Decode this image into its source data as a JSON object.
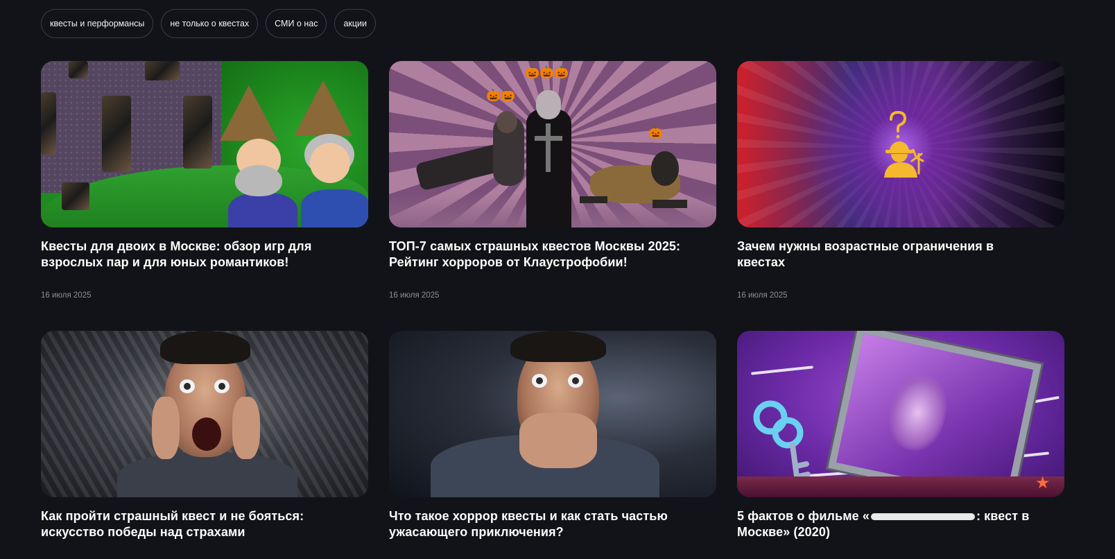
{
  "filters": [
    {
      "label": "квесты и перформансы"
    },
    {
      "label": "не только о квестах"
    },
    {
      "label": "СМИ о нас"
    },
    {
      "label": "акции"
    }
  ],
  "articles": [
    {
      "title": "Квесты для двоих в Москве: обзор игр для взрослых пар и для юных романтиков!",
      "date": "16 июля 2025"
    },
    {
      "title": "ТОП-7 самых страшных квестов Москвы 2025: Рейтинг хорроров от Клаустрофобии!",
      "date": "16 июля 2025"
    },
    {
      "title": "Зачем нужны возрастные ограничения в квестах",
      "date": "16 июля 2025"
    },
    {
      "title": "Как пройти страшный квест и не бояться: искусство победы над страхами"
    },
    {
      "title": "Что такое хоррор квесты и как стать частью ужасающего приключения?"
    },
    {
      "title_prefix": "5 фактов о фильме «",
      "title_suffix": ": квест в Москве» (2020)"
    }
  ],
  "icons": {
    "pumpkin": "🎃"
  },
  "colors": {
    "background": "#121318",
    "chip_border": "#3d3f47",
    "date_text": "#8e8f96",
    "age_icon": "#f5b82e"
  }
}
